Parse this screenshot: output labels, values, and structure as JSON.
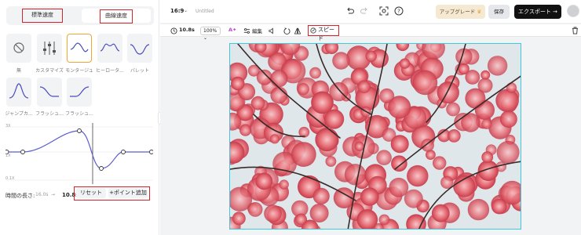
{
  "left": {
    "tabs": [
      "標準速度",
      "曲線速度"
    ],
    "presets": [
      {
        "label": "無",
        "icon": "none-icon"
      },
      {
        "label": "カスタマイズ",
        "icon": "customize-icon"
      },
      {
        "label": "モンタージュ",
        "icon": "montage-curve-icon"
      },
      {
        "label": "ヒーロータ...",
        "icon": "hero-time-curve-icon"
      },
      {
        "label": "バレット",
        "icon": "bullet-curve-icon"
      },
      {
        "label": "ジャンプカ...",
        "icon": "jump-cut-curve-icon"
      },
      {
        "label": "フラッシュ...",
        "icon": "flash-in-curve-icon"
      },
      {
        "label": "フラッシュ...",
        "icon": "flash-out-curve-icon"
      }
    ],
    "graph_labels": {
      "top": "3X",
      "mid": "1X",
      "bottom": "0.1X"
    },
    "duration_label": "時間の長さ:",
    "original_duration": "16.0s",
    "arrow": "→",
    "current_duration": "10.8s",
    "reset_label": "リセット",
    "add_point_label": "+ポイント追加"
  },
  "topbar": {
    "aspect_ratio": "16:9",
    "title_placeholder": "Untitled",
    "upgrade_label": "アップグレード",
    "save_label": "保存",
    "export_label": "エクスポート →"
  },
  "toolbar": {
    "duration": "10.8s",
    "zoom": "100%",
    "edit_label": "編集",
    "speed_label": "スピード"
  },
  "colors": {
    "highlight": "#d9232b",
    "canvas_border": "#3fc9dd",
    "selected_preset": "#f3a531",
    "curve": "#5b5ccf"
  }
}
